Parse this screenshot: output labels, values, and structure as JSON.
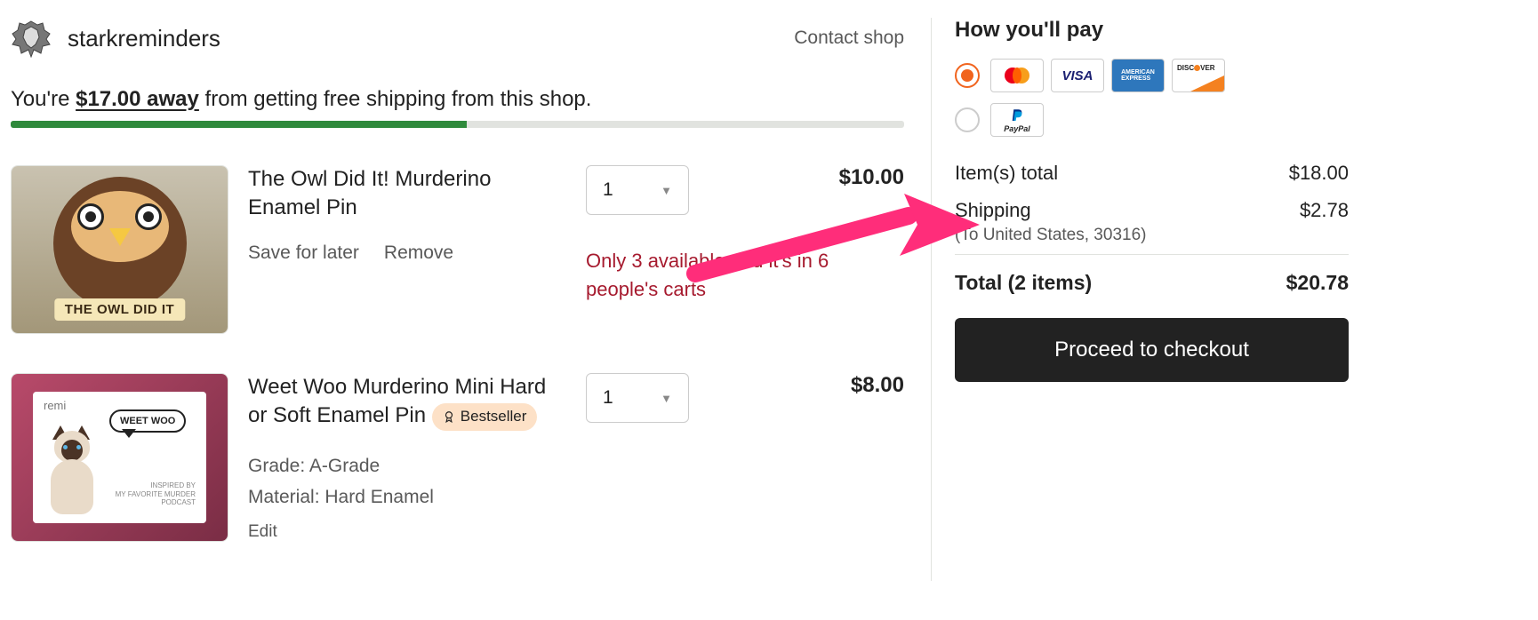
{
  "shop": {
    "name": "starkreminders",
    "contact_label": "Contact shop"
  },
  "free_ship": {
    "prefix": "You're ",
    "amount": "$17.00 away",
    "suffix": " from getting free shipping from this shop.",
    "progress_pct": 51
  },
  "items": [
    {
      "title": "The Owl Did It! Murderino Enamel Pin",
      "save_label": "Save for later",
      "remove_label": "Remove",
      "qty": "1",
      "price": "$10.00",
      "urgency": "Only 3 available and it's in 6 people's carts",
      "banner_text": "THE OWL DID IT"
    },
    {
      "title": "Weet Woo Murderino Mini Hard or Soft Enamel Pin",
      "bestseller_label": "Bestseller",
      "grade_label": "Grade: A-Grade",
      "material_label": "Material: Hard Enamel",
      "edit_label": "Edit",
      "qty": "1",
      "price": "$8.00",
      "bubble_text": "WEET WOO",
      "tag_text": "INSPIRED BY\nMY FAVORITE MURDER\nPODCAST",
      "card_brand": "remi"
    }
  ],
  "payment": {
    "title": "How you'll pay",
    "paypal_label": "PayPal"
  },
  "totals": {
    "items_label": "Item(s) total",
    "items_value": "$18.00",
    "shipping_label": "Shipping",
    "shipping_value": "$2.78",
    "ship_to_prefix": "(To ",
    "ship_to_location": "United States, 30316",
    "ship_to_suffix": ")",
    "grand_label": "Total (2 items)",
    "grand_value": "$20.78"
  },
  "checkout_label": "Proceed to checkout"
}
